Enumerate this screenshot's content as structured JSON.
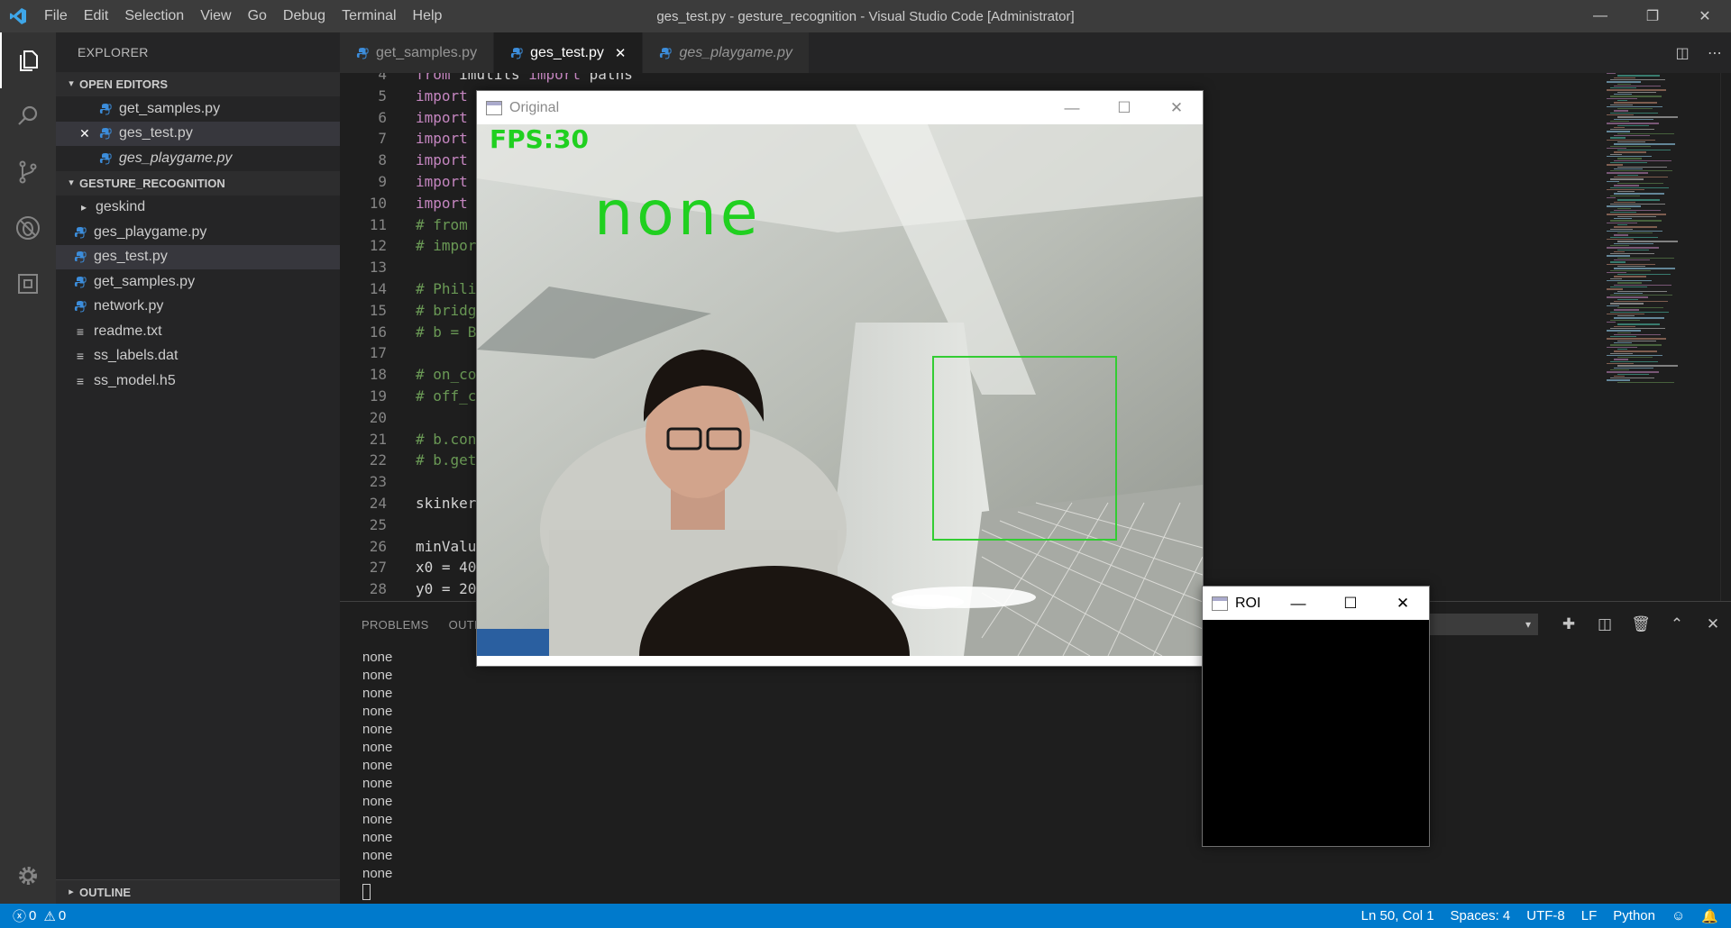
{
  "titlebar": {
    "menu": [
      "File",
      "Edit",
      "Selection",
      "View",
      "Go",
      "Debug",
      "Terminal",
      "Help"
    ],
    "window_title": "ges_test.py - gesture_recognition - Visual Studio Code [Administrator]"
  },
  "sidebar": {
    "title": "EXPLORER",
    "open_editors_label": "OPEN EDITORS",
    "open_editors": [
      {
        "name": "get_samples.py",
        "italic": false
      },
      {
        "name": "ges_test.py",
        "italic": false,
        "selected": true
      },
      {
        "name": "ges_playgame.py",
        "italic": true
      }
    ],
    "project_label": "GESTURE_RECOGNITION",
    "files": [
      {
        "name": "geskind",
        "type": "folder"
      },
      {
        "name": "ges_playgame.py",
        "type": "py"
      },
      {
        "name": "ges_test.py",
        "type": "py",
        "selected": true
      },
      {
        "name": "get_samples.py",
        "type": "py"
      },
      {
        "name": "network.py",
        "type": "py"
      },
      {
        "name": "readme.txt",
        "type": "txt"
      },
      {
        "name": "ss_labels.dat",
        "type": "txt"
      },
      {
        "name": "ss_model.h5",
        "type": "txt"
      }
    ],
    "outline_label": "OUTLINE"
  },
  "tabs": [
    {
      "label": "get_samples.py",
      "active": false,
      "italic": false
    },
    {
      "label": "ges_test.py",
      "active": true,
      "italic": false
    },
    {
      "label": "ges_playgame.py",
      "active": false,
      "italic": true
    }
  ],
  "editor": {
    "lines": [
      {
        "n": "4",
        "parts": [
          [
            "kw",
            "from"
          ],
          [
            "pl",
            " imutils "
          ],
          [
            "kw",
            "import"
          ],
          [
            "pl",
            " paths"
          ]
        ]
      },
      {
        "n": "5",
        "parts": [
          [
            "kw",
            "import"
          ]
        ]
      },
      {
        "n": "6",
        "parts": [
          [
            "kw",
            "import"
          ]
        ]
      },
      {
        "n": "7",
        "parts": [
          [
            "kw",
            "import"
          ]
        ]
      },
      {
        "n": "8",
        "parts": [
          [
            "kw",
            "import"
          ]
        ]
      },
      {
        "n": "9",
        "parts": [
          [
            "kw",
            "import"
          ]
        ]
      },
      {
        "n": "10",
        "parts": [
          [
            "kw",
            "import"
          ]
        ]
      },
      {
        "n": "11",
        "parts": [
          [
            "cm",
            "# from"
          ]
        ]
      },
      {
        "n": "12",
        "parts": [
          [
            "cm",
            "# impor"
          ]
        ]
      },
      {
        "n": "13",
        "parts": []
      },
      {
        "n": "14",
        "parts": [
          [
            "cm",
            "# Phili"
          ]
        ]
      },
      {
        "n": "15",
        "parts": [
          [
            "cm",
            "# bridg"
          ]
        ]
      },
      {
        "n": "16",
        "parts": [
          [
            "cm",
            "# b = B"
          ]
        ]
      },
      {
        "n": "17",
        "parts": []
      },
      {
        "n": "18",
        "parts": [
          [
            "cm",
            "# on_co"
          ]
        ]
      },
      {
        "n": "19",
        "parts": [
          [
            "cm",
            "# off_c"
          ]
        ]
      },
      {
        "n": "20",
        "parts": []
      },
      {
        "n": "21",
        "parts": [
          [
            "cm",
            "# b.con"
          ]
        ]
      },
      {
        "n": "22",
        "parts": [
          [
            "cm",
            "# b.get"
          ]
        ]
      },
      {
        "n": "23",
        "parts": []
      },
      {
        "n": "24",
        "parts": [
          [
            "pl",
            "skinker"
          ]
        ]
      },
      {
        "n": "25",
        "parts": []
      },
      {
        "n": "26",
        "parts": [
          [
            "pl",
            "minValu"
          ]
        ]
      },
      {
        "n": "27",
        "parts": [
          [
            "pl",
            "x0 = 40"
          ]
        ]
      },
      {
        "n": "28",
        "parts": [
          [
            "pl",
            "y0 = 20"
          ]
        ]
      }
    ]
  },
  "panel": {
    "tabs": [
      "PROBLEMS",
      "OUTP"
    ],
    "terminal_lines": [
      "none",
      "none",
      "none",
      "none",
      "none",
      "none",
      "none",
      "none",
      "none",
      "none",
      "none",
      "none",
      "none"
    ]
  },
  "statusbar": {
    "errors": "0",
    "warnings": "0",
    "position": "Ln 50, Col 1",
    "spaces": "Spaces: 4",
    "encoding": "UTF-8",
    "eol": "LF",
    "language": "Python"
  },
  "original_window": {
    "title": "Original",
    "fps_text": "FPS:30",
    "gesture_text": "none"
  },
  "roi_window": {
    "title": "ROI"
  },
  "colors": {
    "accent": "#007acc",
    "overlay_green": "#20d020"
  }
}
